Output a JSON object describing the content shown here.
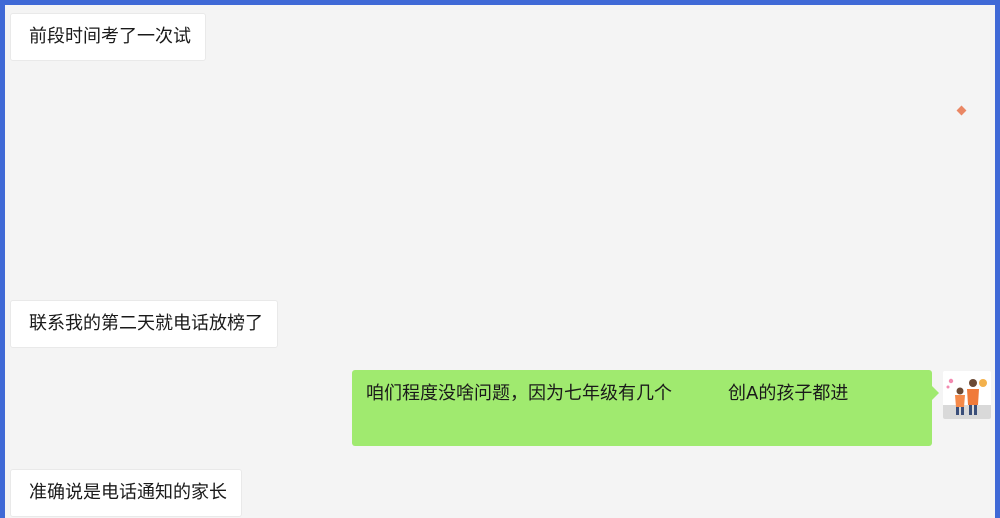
{
  "messages": [
    {
      "side": "in",
      "text": "前段时间考了一次试"
    },
    {
      "side": "in",
      "text": "联系我的第二天就电话放榜了"
    },
    {
      "side": "out",
      "text_part1": "咱们程度没啥问题，因为七年级有几个",
      "text_part2": "创A的孩子都进"
    },
    {
      "side": "in",
      "text": "准确说是电话通知的家长"
    }
  ],
  "colors": {
    "frame_border": "#3f69d6",
    "chat_background": "#f4f4f4",
    "incoming_bubble": "#ffffff",
    "outgoing_bubble": "#a0ea6f"
  },
  "icons": {
    "avatar": "user-avatar-icon",
    "sticker": "small-sticker-icon"
  }
}
